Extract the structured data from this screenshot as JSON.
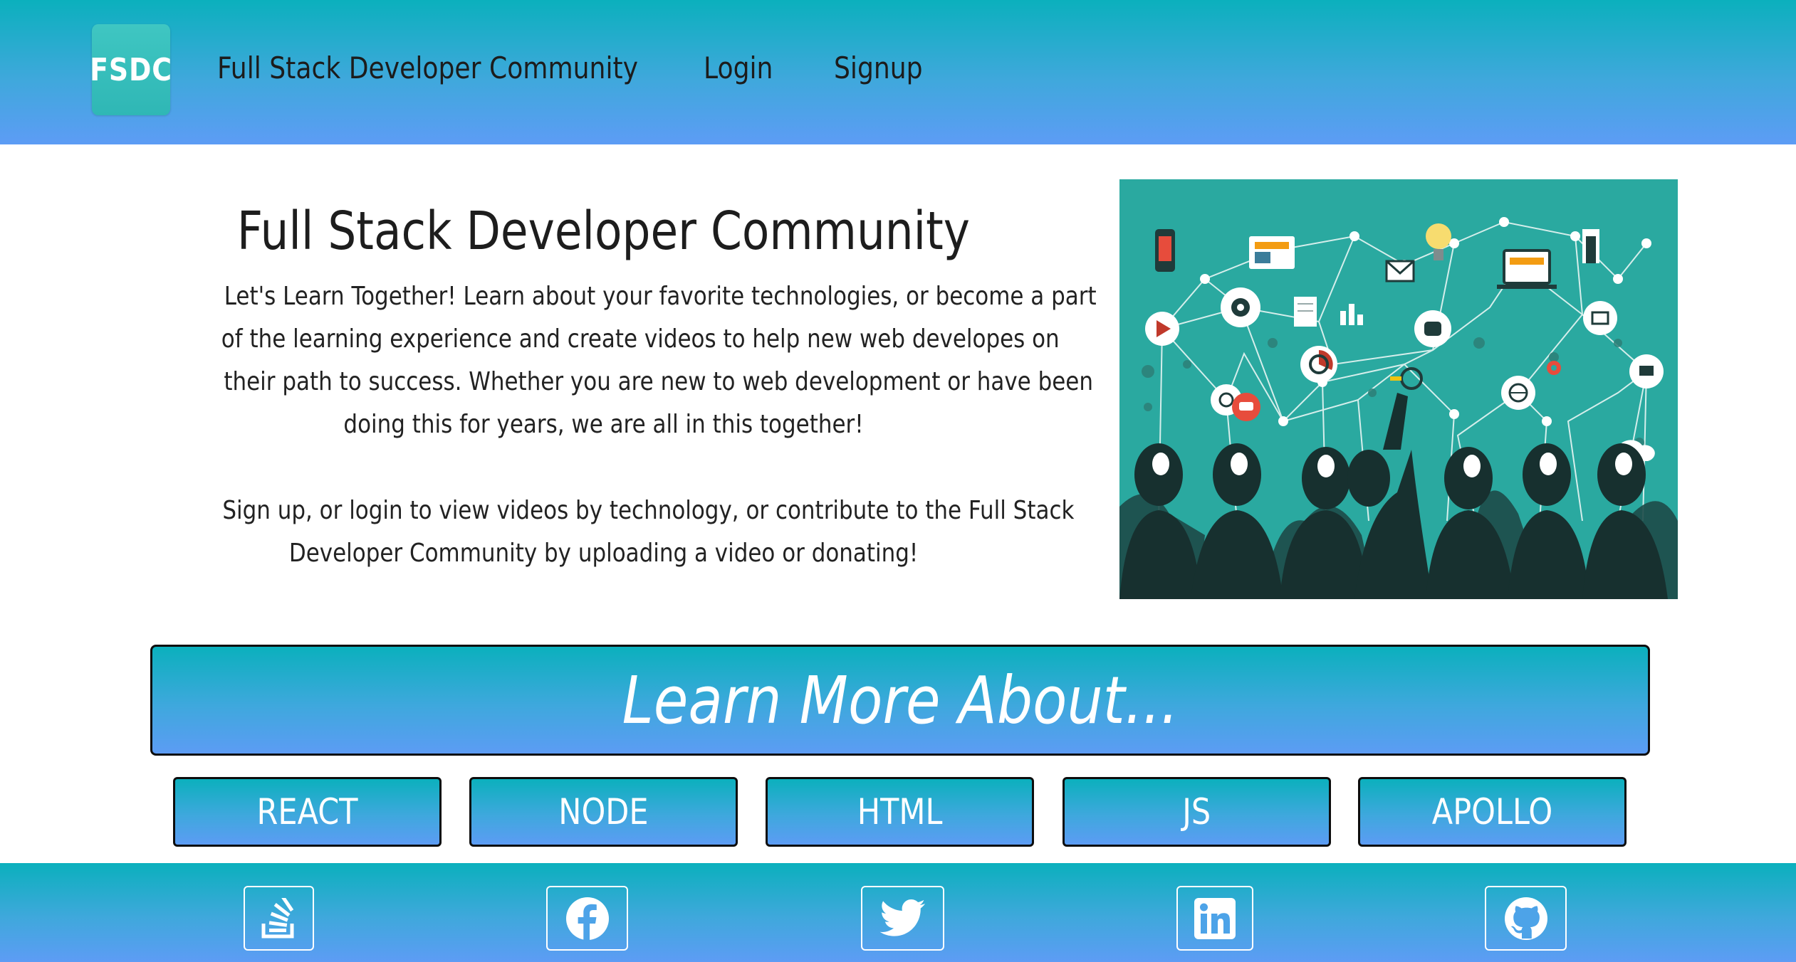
{
  "header": {
    "logo_text": "FSDC",
    "brand_link": "Full Stack Developer Community",
    "nav": {
      "login": "Login",
      "signup": "Signup"
    }
  },
  "intro": {
    "title": "Full Stack Developer Community",
    "paragraph1_lines": [
      "Let's Learn Together! Learn about your favorite technologies, or become a part",
      "of the learning experience and create videos to help new web developes on",
      "their path to success. Whether you are new to web development or have been",
      "doing this for years, we are all in this together!"
    ],
    "paragraph2_lines": [
      "Sign up, or login to view videos by technology, or contribute to the Full Stack",
      "Developer Community by uploading a video or donating!"
    ]
  },
  "learn_more": {
    "banner": "Learn More About...",
    "buttons": {
      "react": "REACT",
      "node": "NODE",
      "html": "HTML",
      "js": "JS",
      "apollo": "APOLLO"
    }
  },
  "footer": {
    "social_icons": [
      "stackoverflow-icon",
      "facebook-icon",
      "twitter-icon",
      "linkedin-icon",
      "github-icon"
    ]
  },
  "colors": {
    "gradient_top": "#0bb0bd",
    "gradient_bottom": "#5d9cf5",
    "hero_bg": "#2aa9a0",
    "text_dark": "#1d1d1d"
  }
}
